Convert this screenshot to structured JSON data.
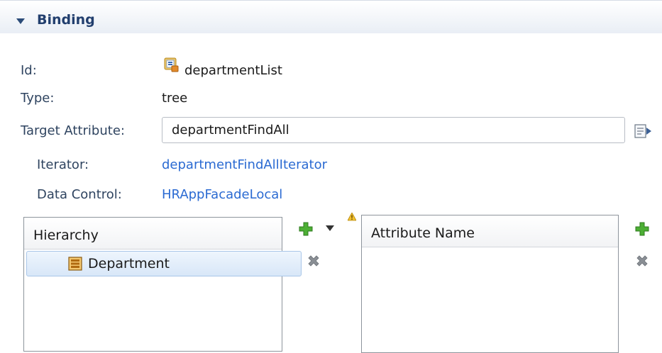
{
  "section": {
    "title": "Binding"
  },
  "fields": {
    "id_label": "Id:",
    "id_value": "departmentList",
    "type_label": "Type:",
    "type_value": "tree",
    "target_label": "Target Attribute:",
    "target_value": "departmentFindAll",
    "iterator_label": "Iterator:",
    "iterator_value": "departmentFindAllIterator",
    "datacontrol_label": "Data Control:",
    "datacontrol_value": "HRAppFacadeLocal"
  },
  "hierarchy": {
    "header": "Hierarchy",
    "items": [
      {
        "label": "Department"
      }
    ]
  },
  "attributes": {
    "header": "Attribute Name",
    "items": []
  },
  "icons": {
    "id": "binding-icon",
    "target_edit": "edit-icon",
    "add": "add-icon",
    "remove": "remove-icon",
    "dropdown": "dropdown-icon",
    "warning": "warning-icon",
    "node": "collection-icon"
  },
  "colors": {
    "accent": "#223f6e",
    "link": "#2a6ad2",
    "add": "#3fa62f",
    "remove": "#8a8f95",
    "warning": "#e8b21a",
    "selection": "#d8e7f8"
  }
}
